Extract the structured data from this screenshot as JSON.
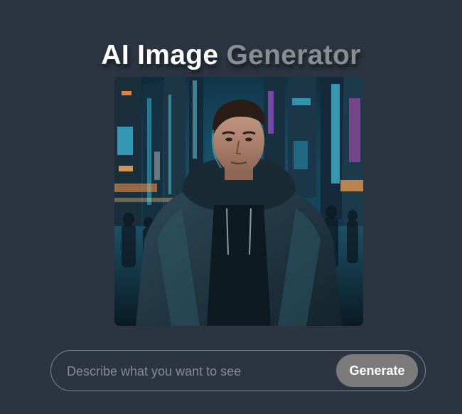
{
  "header": {
    "title_part1": "AI Image",
    "title_part2": "Generator"
  },
  "result_image": {
    "alt": "",
    "subject": "man-in-hooded-jacket-neon-city-portrait"
  },
  "prompt": {
    "value": "",
    "placeholder": "Describe what you want to see",
    "button_label": "Generate"
  },
  "colors": {
    "background": "#2b3440",
    "title_primary": "#ffffff",
    "title_secondary": "#8a8d91",
    "button_bg": "#7b7b7b",
    "input_border": "#7e858e"
  }
}
